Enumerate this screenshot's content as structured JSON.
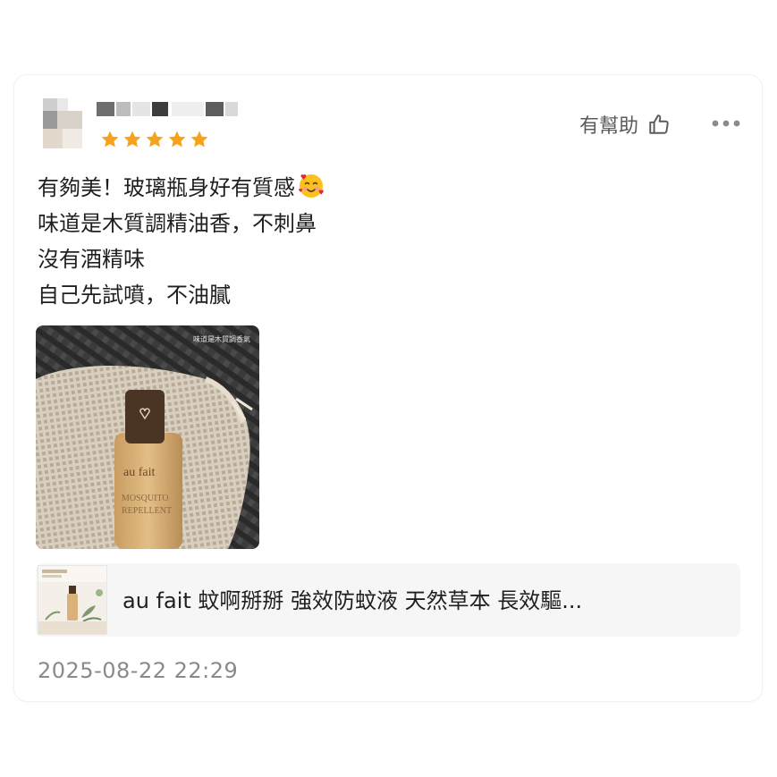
{
  "review": {
    "rating": 5,
    "rating_max": 5,
    "helpful_label": "有幫助",
    "lines": [
      "有夠美！玻璃瓶身好有質感",
      "味道是木質調精油香，不刺鼻",
      "沒有酒精味",
      "自己先試噴，不油膩"
    ],
    "photo_caption": "味道是木質調香氣",
    "bottle_brand": "au fait",
    "timestamp": "2025-08-22 22:29"
  },
  "product": {
    "name": "au fait 蚊啊掰掰 強效防蚊液 天然草本 長效驅..."
  },
  "icons": {
    "thumb_up": "thumbs-up-icon",
    "more": "more-dots-icon",
    "star": "star-icon",
    "emoji": "smiling-face-with-hearts-emoji"
  },
  "colors": {
    "star": "#f7a21b",
    "text": "#1f1f1f",
    "muted": "#8a8a8a",
    "product_bg": "#f6f6f6"
  }
}
